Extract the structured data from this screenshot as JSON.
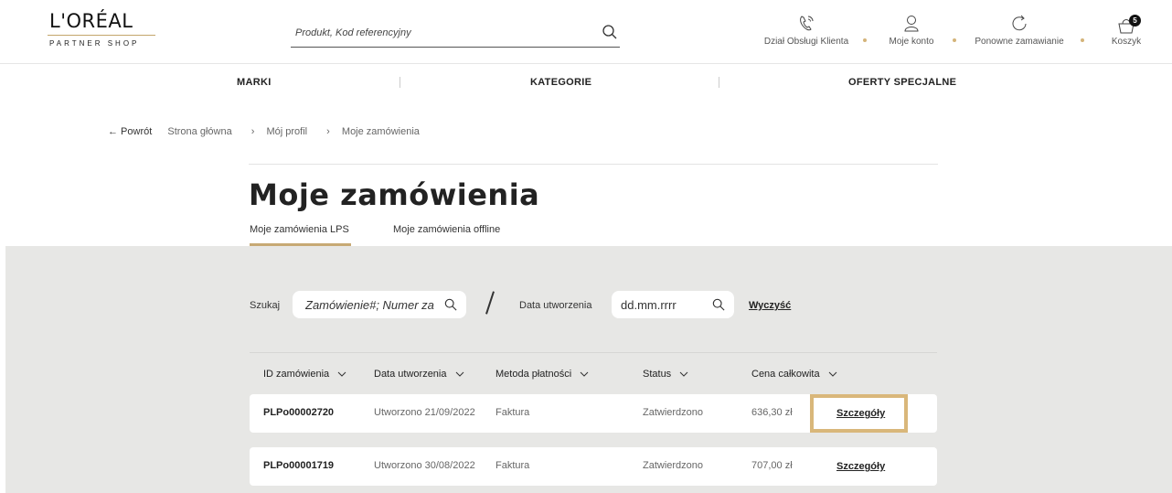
{
  "brand": {
    "name": "L'ORÉAL",
    "subtitle": "PARTNER SHOP",
    "accent": "#c7a974"
  },
  "search": {
    "placeholder": "Produkt, Kod referencyjny",
    "icon": "search-icon"
  },
  "top_links": [
    {
      "label": "Dział Obsługi Klienta",
      "icon": "phone-icon"
    },
    {
      "label": "Moje konto",
      "icon": "user-icon"
    },
    {
      "label": "Ponowne zamawianie",
      "icon": "refresh-icon"
    },
    {
      "label": "Koszyk",
      "icon": "cart-icon",
      "badge": "5"
    }
  ],
  "nav": {
    "items": [
      "MARKI",
      "KATEGORIE",
      "OFERTY SPECJALNE"
    ]
  },
  "breadcrumb": {
    "back": "← Powrót",
    "items": [
      "Strona główna",
      "›",
      "Mój profil",
      "›",
      "Moje zamówienia"
    ]
  },
  "page": {
    "title": "Moje zamówienia"
  },
  "tabs": [
    {
      "label": "Moje zamówienia LPS",
      "active": true
    },
    {
      "label": "Moje zamówienia offline",
      "active": false
    }
  ],
  "filters": {
    "search_label": "Szukaj",
    "search_placeholder": "Zamówienie#; Numer za",
    "date_label": "Data utworzenia",
    "date_placeholder": "dd.mm.rrrr",
    "clear_label": "Wyczyść"
  },
  "table": {
    "columns": [
      "ID zamówienia",
      "Data utworzenia",
      "Metoda płatności",
      "Status",
      "Cena całkowita"
    ],
    "rows": [
      {
        "id": "PLPo00002720",
        "date": "Utworzono 21/09/2022",
        "payment": "Faktura",
        "status": "Zatwierdzono",
        "total": "636,30 zł",
        "action": "Szczegóły",
        "highlighted": true
      },
      {
        "id": "PLPo00001719",
        "date": "Utworzono 30/08/2022",
        "payment": "Faktura",
        "status": "Zatwierdzono",
        "total": "707,00 zł",
        "action": "Szczegóły",
        "highlighted": false
      }
    ]
  }
}
